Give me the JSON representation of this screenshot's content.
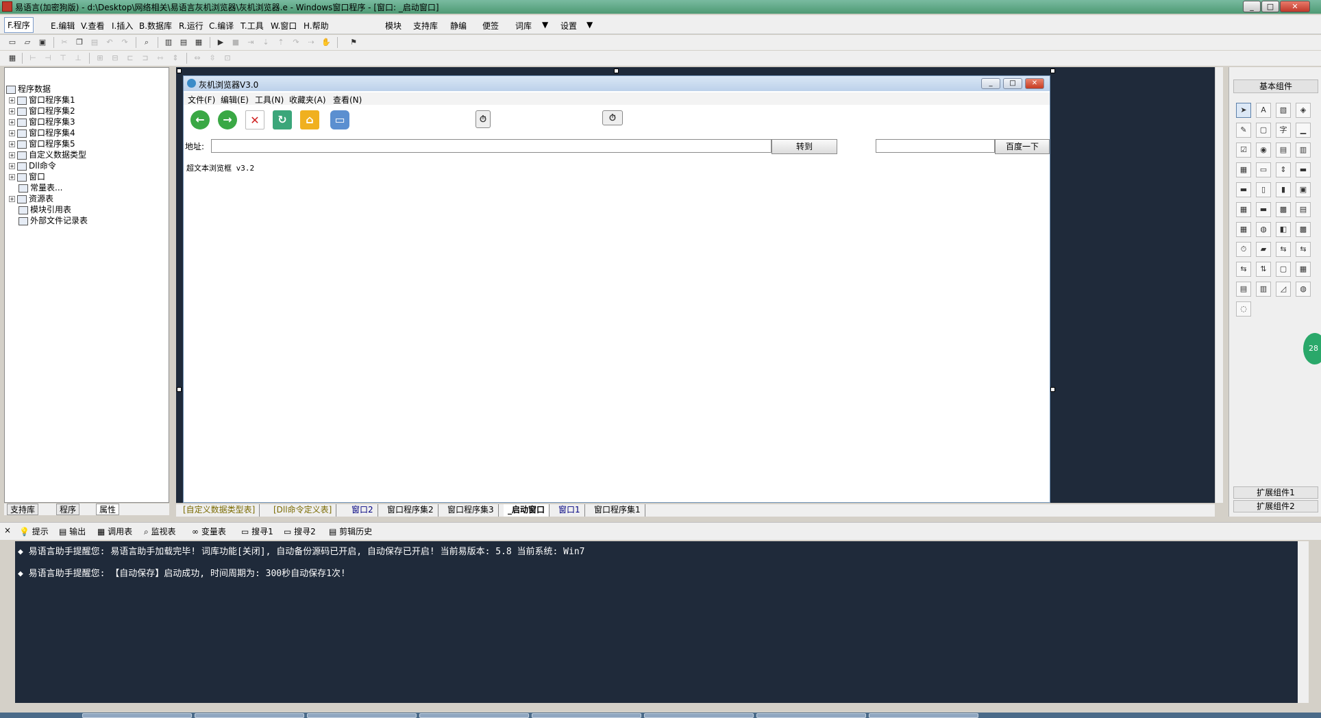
{
  "window": {
    "title": "易语言(加密狗版) - d:\\Desktop\\网络相关\\易语言灰机浏览器\\灰机浏览器.e - Windows窗口程序 - [窗口: _启动窗口]",
    "min": "_",
    "max": "□",
    "close": "✕"
  },
  "menu": {
    "items": [
      "F.程序",
      "E.编辑",
      "V.查看",
      "I.插入",
      "B.数据库",
      "R.运行",
      "C.编译",
      "T.工具",
      "W.窗口",
      "H.帮助",
      "模块",
      "支持库",
      "静编",
      "便签",
      "词库",
      "设置"
    ],
    "dropdown": "▼"
  },
  "left_panel": {
    "tree": [
      {
        "label": "程序数据",
        "expand": ""
      },
      {
        "label": "窗口程序集1",
        "expand": "+"
      },
      {
        "label": "窗口程序集2",
        "expand": "+"
      },
      {
        "label": "窗口程序集3",
        "expand": "+"
      },
      {
        "label": "窗口程序集4",
        "expand": "+"
      },
      {
        "label": "窗口程序集5",
        "expand": "+"
      },
      {
        "label": "自定义数据类型",
        "expand": "+"
      },
      {
        "label": "Dll命令",
        "expand": "+"
      },
      {
        "label": "窗口",
        "expand": "+"
      },
      {
        "label": "常量表...",
        "expand": ""
      },
      {
        "label": "资源表",
        "expand": "+"
      },
      {
        "label": "模块引用表",
        "expand": ""
      },
      {
        "label": "外部文件记录表",
        "expand": ""
      }
    ],
    "tabs": [
      "支持库",
      "程序",
      "属性"
    ]
  },
  "form": {
    "title": "灰机浏览器V3.0",
    "menu": [
      "文件(F)",
      "编辑(E)",
      "工具(N)",
      "收藏夹(A)",
      "查看(N)"
    ],
    "address_label": "地址:",
    "go_button": "转到",
    "baidu_button": "百度一下",
    "html_text": "超文本浏览框 v3.2"
  },
  "right_panel": {
    "header": "基本组件",
    "ext1": "扩展组件1",
    "ext2": "扩展组件2",
    "bubble": "28"
  },
  "doc_tabs": [
    {
      "label": "[自定义数据类型表]",
      "style": "yellow"
    },
    {
      "label": "[Dll命令定义表]",
      "style": "yellow"
    },
    {
      "label": "窗口2",
      "style": "blue"
    },
    {
      "label": "窗口程序集2",
      "style": ""
    },
    {
      "label": "窗口程序集3",
      "style": ""
    },
    {
      "label": "_启动窗口",
      "style": "active"
    },
    {
      "label": "窗口1",
      "style": "blue"
    },
    {
      "label": "窗口程序集1",
      "style": ""
    }
  ],
  "output_tabs": [
    "提示",
    "输出",
    "调用表",
    "监视表",
    "变量表",
    "搜寻1",
    "搜寻2",
    "剪辑历史"
  ],
  "output_lines": [
    "◆ 易语言助手提醒您:  易语言助手加载完毕! 词库功能[关闭], 自动备份源码已开启, 自动保存已开启!  当前易版本: 5.8  当前系统: Win7",
    "◆ 易语言助手提醒您: 【自动保存】启动成功, 时间周期为: 300秒自动保存1次!"
  ]
}
